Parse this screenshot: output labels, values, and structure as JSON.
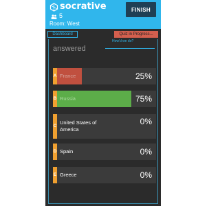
{
  "header": {
    "brand": "socrative",
    "student_count": "5",
    "room": "Room: West",
    "finish_label": "FINISH"
  },
  "tabs": {
    "dashboard": "Dashboard",
    "quiz": "Quiz in Progress..."
  },
  "main": {
    "heading": "answered",
    "link": "How'd we do?"
  },
  "answers": [
    {
      "letter": "A",
      "label": "France",
      "percent": "25%",
      "share": 0.25,
      "color": "#c0503f",
      "label_color": "#d7a59d"
    },
    {
      "letter": "B",
      "label": "Russia",
      "percent": "75%",
      "share": 0.75,
      "color": "#5cad49",
      "label_color": "#a9d99d"
    },
    {
      "letter": "C",
      "label": "United States of America",
      "percent": "0%",
      "share": 0,
      "color": "#3b3b3b",
      "label_color": "#ffffff"
    },
    {
      "letter": "D",
      "label": "Spain",
      "percent": "0%",
      "share": 0,
      "color": "#3b3b3b",
      "label_color": "#ffffff"
    },
    {
      "letter": "E",
      "label": "Greece",
      "percent": "0%",
      "share": 0,
      "color": "#3b3b3b",
      "label_color": "#ffffff"
    }
  ],
  "colors": {
    "brand_blue": "#30b6ec",
    "finish_bg": "#1f3f55",
    "letter_orange": "#f0a030",
    "quiz_tab": "#d35f4e"
  }
}
